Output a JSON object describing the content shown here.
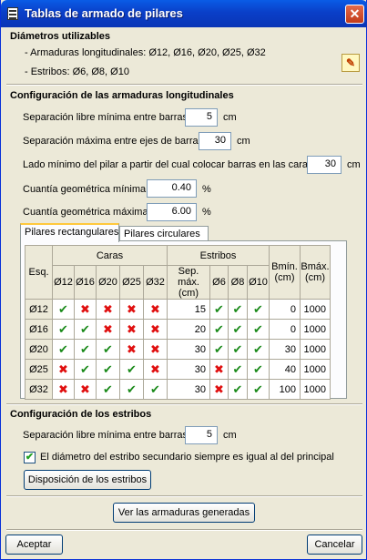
{
  "window": {
    "title": "Tablas de armado de pilares",
    "close": "✕"
  },
  "diametros": {
    "title": "Diámetros utilizables",
    "longitudinales": "- Armaduras longitudinales: Ø12, Ø16, Ø20, Ø25, Ø32",
    "estribos": "- Estribos: Ø6, Ø8, Ø10"
  },
  "config_long": {
    "title": "Configuración de las armaduras longitudinales",
    "sep_min_label": "Separación libre mínima entre barras",
    "sep_min_value": "5",
    "sep_min_unit": "cm",
    "sep_max_label": "Separación máxima entre ejes de barras",
    "sep_max_value": "30",
    "sep_max_unit": "cm",
    "lado_min_label": "Lado mínimo del pilar a partir del cual colocar barras en las caras",
    "lado_min_value": "30",
    "lado_min_unit": "cm",
    "cuantia_min_label": "Cuantía geométrica mínima",
    "cuantia_min_value": "0.40",
    "cuantia_min_unit": "%",
    "cuantia_max_label": "Cuantía geométrica máxima",
    "cuantia_max_value": "6.00",
    "cuantia_max_unit": "%"
  },
  "tabs": [
    "Pilares rectangulares",
    "Pilares circulares"
  ],
  "table": {
    "esq": "Esq.",
    "caras": "Caras",
    "estribos": "Estribos",
    "bmin": "Bmín. (cm)",
    "bmax": "Bmáx. (cm)",
    "sep_max": "Sep. máx. (cm)",
    "caras_cols": [
      "Ø12",
      "Ø16",
      "Ø20",
      "Ø25",
      "Ø32"
    ],
    "estribo_cols": [
      "Ø6",
      "Ø8",
      "Ø10"
    ],
    "rows": [
      {
        "esq": "Ø12",
        "caras": [
          "ok",
          "no",
          "no",
          "no",
          "no"
        ],
        "sep": "15",
        "estribos": [
          "ok",
          "ok",
          "ok"
        ],
        "bmin": "0",
        "bmax": "1000"
      },
      {
        "esq": "Ø16",
        "caras": [
          "ok",
          "ok",
          "no",
          "no",
          "no"
        ],
        "sep": "20",
        "estribos": [
          "ok",
          "ok",
          "ok"
        ],
        "bmin": "0",
        "bmax": "1000"
      },
      {
        "esq": "Ø20",
        "caras": [
          "ok",
          "ok",
          "ok",
          "no",
          "no"
        ],
        "sep": "30",
        "estribos": [
          "ok",
          "ok",
          "ok"
        ],
        "bmin": "30",
        "bmax": "1000"
      },
      {
        "esq": "Ø25",
        "caras": [
          "no",
          "ok",
          "ok",
          "ok",
          "no"
        ],
        "sep": "30",
        "estribos": [
          "no",
          "ok",
          "ok"
        ],
        "bmin": "40",
        "bmax": "1000"
      },
      {
        "esq": "Ø32",
        "caras": [
          "no",
          "no",
          "ok",
          "ok",
          "ok"
        ],
        "sep": "30",
        "estribos": [
          "no",
          "ok",
          "ok"
        ],
        "bmin": "100",
        "bmax": "1000"
      }
    ]
  },
  "config_estribos": {
    "title": "Configuración de los estribos",
    "sep_min_label": "Separación libre mínima entre barras",
    "sep_min_value": "5",
    "sep_min_unit": "cm",
    "checkbox_label": "El diámetro del estribo secundario siempre es igual al del principal",
    "checked": true,
    "disposicion_btn": "Disposición de los estribos"
  },
  "ver_btn": "Ver las armaduras generadas",
  "aceptar_btn": "Aceptar",
  "cancelar_btn": "Cancelar",
  "glyphs": {
    "ok": "✔",
    "no": "✖",
    "check": "✔"
  },
  "colors": {
    "ok": "#1a8a1a",
    "no": "#e01010",
    "title_bar": "#0a5ce6",
    "tab_highlight": "#ffc83c"
  }
}
